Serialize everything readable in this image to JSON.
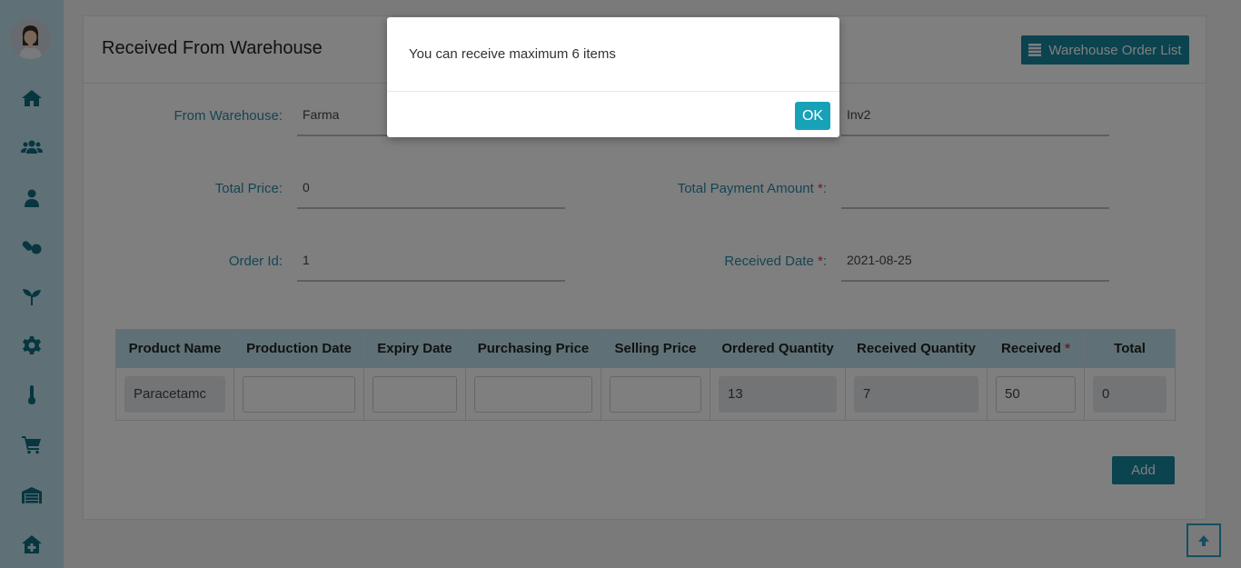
{
  "sidebar": {
    "items": [
      {
        "icon": "home-icon"
      },
      {
        "icon": "users-icon"
      },
      {
        "icon": "user-icon"
      },
      {
        "icon": "pills-icon"
      },
      {
        "icon": "seedling-icon"
      },
      {
        "icon": "gear-icon"
      },
      {
        "icon": "thermometer-icon"
      },
      {
        "icon": "cart-icon"
      },
      {
        "icon": "warehouse-icon"
      },
      {
        "icon": "house-medical-icon"
      }
    ]
  },
  "header": {
    "title": "Received From Warehouse",
    "order_list_label": "Warehouse Order List"
  },
  "form": {
    "from_warehouse": {
      "label": "From Warehouse:",
      "value": "Farma"
    },
    "invoice": {
      "value": "Inv2"
    },
    "total_price": {
      "label": "Total Price:",
      "value": "0"
    },
    "total_payment": {
      "label": "Total Payment Amount",
      "required": "*",
      "colon": ":",
      "value": ""
    },
    "order_id": {
      "label": "Order Id:",
      "value": "1"
    },
    "received_date": {
      "label": "Received Date",
      "required": "*",
      "colon": ":",
      "value": "2021-08-25"
    }
  },
  "table": {
    "headers": [
      "Product Name",
      "Production Date",
      "Expiry Date",
      "Purchasing Price",
      "Selling Price",
      "Ordered Quantity",
      "Received Quantity",
      "Received",
      "Total"
    ],
    "received_required": "*",
    "row": {
      "product_name": "Paracetamc",
      "production_date": "",
      "expiry_date": "",
      "purchasing_price": "",
      "selling_price": "",
      "ordered_quantity": "13",
      "received_quantity": "7",
      "received": "50",
      "total": "0"
    }
  },
  "add_label": "Add",
  "modal": {
    "message": "You can receive maximum 6 items",
    "ok_label": "OK"
  },
  "colors": {
    "accent": "#17869e",
    "sidebar": "#bfe3ec",
    "modal_button": "#17a2b8"
  }
}
